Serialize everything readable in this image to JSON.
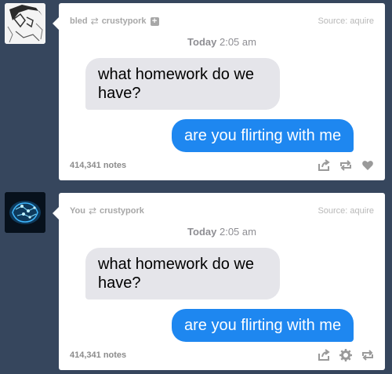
{
  "posts": [
    {
      "author": "bled",
      "reblogged_from": "crustypork",
      "follow_symbol": "+",
      "source_label": "Source:",
      "source": "aquire",
      "timestamp_day": "Today",
      "timestamp_time": "2:05 am",
      "message_in": "what homework do we have?",
      "message_out": "are you flirting with me",
      "notes": "414,341 notes",
      "actions": [
        "share-icon",
        "reblog-icon",
        "like-icon"
      ],
      "avatar": "anime-sketch-avatar"
    },
    {
      "author": "You",
      "reblogged_from": "crustypork",
      "source_label": "Source:",
      "source": "aquire",
      "timestamp_day": "Today",
      "timestamp_time": "2:05 am",
      "message_in": "what homework do we have?",
      "message_out": "are you flirting with me",
      "notes": "414,341 notes",
      "actions": [
        "share-icon",
        "settings-icon",
        "reblog-icon"
      ],
      "avatar": "glowing-brain-avatar"
    }
  ],
  "colors": {
    "background": "#36465d",
    "bubble_in": "#e5e5ea",
    "bubble_out": "#1e87f0"
  }
}
